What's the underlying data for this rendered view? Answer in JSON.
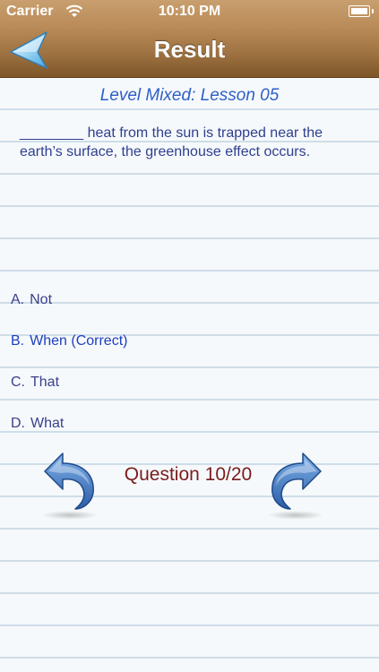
{
  "status_bar": {
    "carrier": "Carrier",
    "time": "10:10 PM"
  },
  "nav": {
    "title": "Result",
    "back_icon": "back-arrow-icon"
  },
  "lesson": {
    "title": "Level Mixed: Lesson 05"
  },
  "question": {
    "text": "________ heat from the sun is trapped near the earth’s surface, the greenhouse effect occurs."
  },
  "answers": [
    {
      "letter": "A.",
      "text": "Not",
      "correct": false
    },
    {
      "letter": "B.",
      "text": "When (Correct)",
      "correct": true
    },
    {
      "letter": "C.",
      "text": "That",
      "correct": false
    },
    {
      "letter": "D.",
      "text": "What",
      "correct": false
    }
  ],
  "pager": {
    "counter": "Question 10/20",
    "prev_icon": "curved-arrow-left-icon",
    "next_icon": "curved-arrow-right-icon"
  },
  "colors": {
    "nav_wood": "#a9793f",
    "lesson_title": "#2e5fc7",
    "question_text": "#2f3f8f",
    "correct_answer": "#1e3fc0",
    "counter": "#7a1c1c",
    "arrow_blue": "#3b6fb8"
  }
}
